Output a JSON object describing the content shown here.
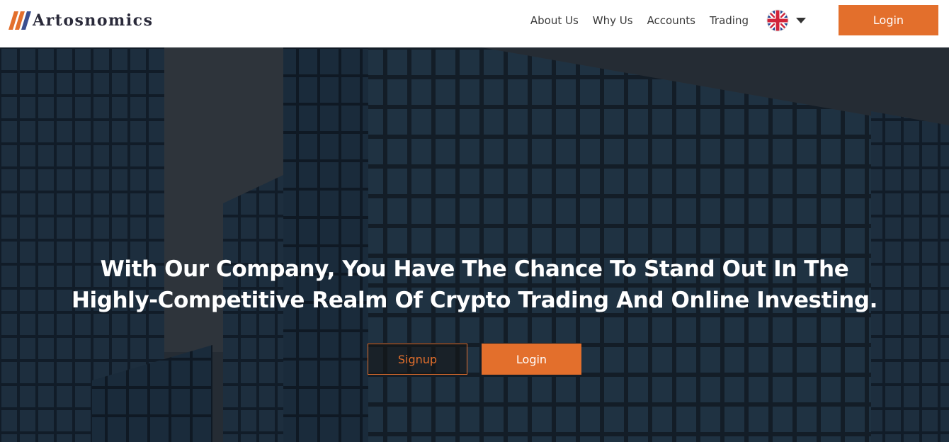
{
  "brand": {
    "name": "Artosnomics",
    "logo_colors": [
      "#e36f2c",
      "#3b4f8f"
    ]
  },
  "nav": {
    "items": [
      {
        "label": "About Us"
      },
      {
        "label": "Why Us"
      },
      {
        "label": "Accounts"
      },
      {
        "label": "Trading"
      }
    ],
    "language_icon": "uk-flag-icon",
    "login_label": "Login"
  },
  "hero": {
    "headline_line1": "With Our Company, You Have The Chance To Stand Out In The",
    "headline_line2": "Highly-Competitive Realm Of Crypto Trading And Online Investing.",
    "signup_label": "Signup",
    "login_label": "Login"
  },
  "colors": {
    "accent": "#e36f2c",
    "header_bg": "#ffffff",
    "hero_overlay": "#1e2731"
  }
}
